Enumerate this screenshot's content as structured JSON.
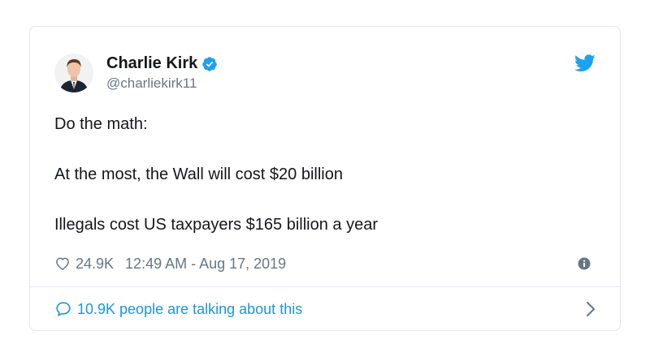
{
  "tweet": {
    "author": {
      "display_name": "Charlie Kirk",
      "handle": "@charliekirk11",
      "verified": true
    },
    "text_lines": [
      "Do the math:",
      "At the most, the Wall will cost $20 billion",
      "Illegals cost US taxpayers $165 billion a year"
    ],
    "likes": "24.9K",
    "timestamp": "12:49 AM - Aug 17, 2019",
    "conversation": "10.9K people are talking about this"
  },
  "icons": {
    "brand": "twitter-bird-icon",
    "verified": "verified-badge-icon",
    "like": "heart-icon",
    "info": "info-icon",
    "reply": "speech-bubble-icon",
    "more": "chevron-right-icon"
  },
  "colors": {
    "brand_blue": "#1da1f2",
    "link_blue": "#1b95e0",
    "text_primary": "#14171a",
    "text_secondary": "#657786",
    "border": "#e1e8ed"
  }
}
